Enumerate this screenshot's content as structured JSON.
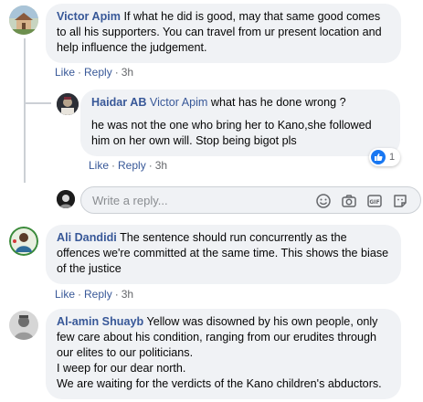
{
  "comments": [
    {
      "author": "Victor Apim",
      "text": "If what he did is good, may that same good comes to all his supporters. You can travel from ur present location and help influence the judgement.",
      "like_label": "Like",
      "reply_label": "Reply",
      "time": "3h"
    },
    {
      "author": "Ali Dandidi",
      "text": "The sentence should run concurrently as the offences we're committed at the same time. This shows the biase of the justice",
      "like_label": "Like",
      "reply_label": "Reply",
      "time": "3h"
    },
    {
      "author": "Al-amin Shuayb",
      "text": "Yellow was disowned by his own people, only few care about his condition, ranging from our erudites through our elites to our politicians.",
      "text2": "I weep for our dear north.",
      "text3": "We are waiting for the verdicts of the Kano children's abductors."
    }
  ],
  "reply": {
    "author": "Haidar AB",
    "mention": "Victor Apim",
    "text": "what has he done wrong ?",
    "text2": "he was not the one who bring her to Kano,she followed him on her own will. Stop being bigot pls",
    "like_label": "Like",
    "reply_label": "Reply",
    "time": "3h",
    "reaction_count": "1"
  },
  "reply_box": {
    "placeholder": "Write a reply..."
  },
  "separator": "·",
  "icons": [
    "smile-icon",
    "camera-icon",
    "gif-icon",
    "sticker-icon",
    "like-reaction-icon"
  ],
  "colors": {
    "link": "#385898",
    "bubble": "#f0f2f5",
    "like": "#1877f2"
  }
}
